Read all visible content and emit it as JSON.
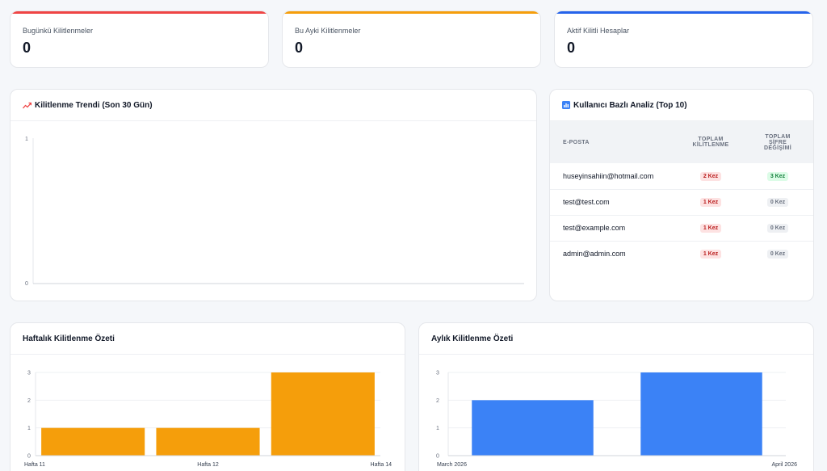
{
  "stats": [
    {
      "label": "Bugünkü Kilitlenmeler",
      "value": "0",
      "color": "#ef4444"
    },
    {
      "label": "Bu Ayki Kilitlenmeler",
      "value": "0",
      "color": "#f59e0b"
    },
    {
      "label": "Aktif Kilitli Hesaplar",
      "value": "0",
      "color": "#2563eb"
    }
  ],
  "trend": {
    "title": "Kilitlenme Trendi (Son 30 Gün)",
    "icon": "trending-up-icon"
  },
  "users": {
    "title": "Kullanıcı Bazlı Analiz (Top 10)",
    "icon": "bar-chart-icon",
    "columns": [
      "E-POSTA",
      "TOPLAM KİLİTLENME",
      "TOPLAM ŞİFRE DEĞİŞİMİ"
    ],
    "rows": [
      {
        "email": "huseyinsahiin@hotmail.com",
        "locks": "2 Kez",
        "changes": "3 Kez"
      },
      {
        "email": "test@test.com",
        "locks": "1 Kez",
        "changes": "0 Kez"
      },
      {
        "email": "test@example.com",
        "locks": "1 Kez",
        "changes": "0 Kez"
      },
      {
        "email": "admin@admin.com",
        "locks": "1 Kez",
        "changes": "0 Kez"
      }
    ]
  },
  "weekly": {
    "title": "Haftalık Kilitlenme Özeti"
  },
  "monthly": {
    "title": "Aylık Kilitlenme Özeti"
  },
  "chart_data": [
    {
      "type": "line",
      "title": "Kilitlenme Trendi (Son 30 Gün)",
      "x": [],
      "values": [],
      "ylim": [
        0,
        1
      ],
      "yticks": [
        0,
        1
      ],
      "grid": false
    },
    {
      "type": "bar",
      "title": "Haftalık Kilitlenme Özeti",
      "categories": [
        "Hafta 11",
        "Hafta 12",
        "Hafta 14"
      ],
      "values": [
        1,
        1,
        3
      ],
      "ylim": [
        0,
        3
      ],
      "yticks": [
        0,
        1,
        2,
        3
      ],
      "color": "#f59e0b",
      "grid": true
    },
    {
      "type": "bar",
      "title": "Aylık Kilitlenme Özeti",
      "categories": [
        "March 2026",
        "April 2026"
      ],
      "values": [
        2,
        3
      ],
      "ylim": [
        0,
        3
      ],
      "yticks": [
        0,
        1,
        2,
        3
      ],
      "color": "#3b82f6",
      "grid": true
    }
  ]
}
